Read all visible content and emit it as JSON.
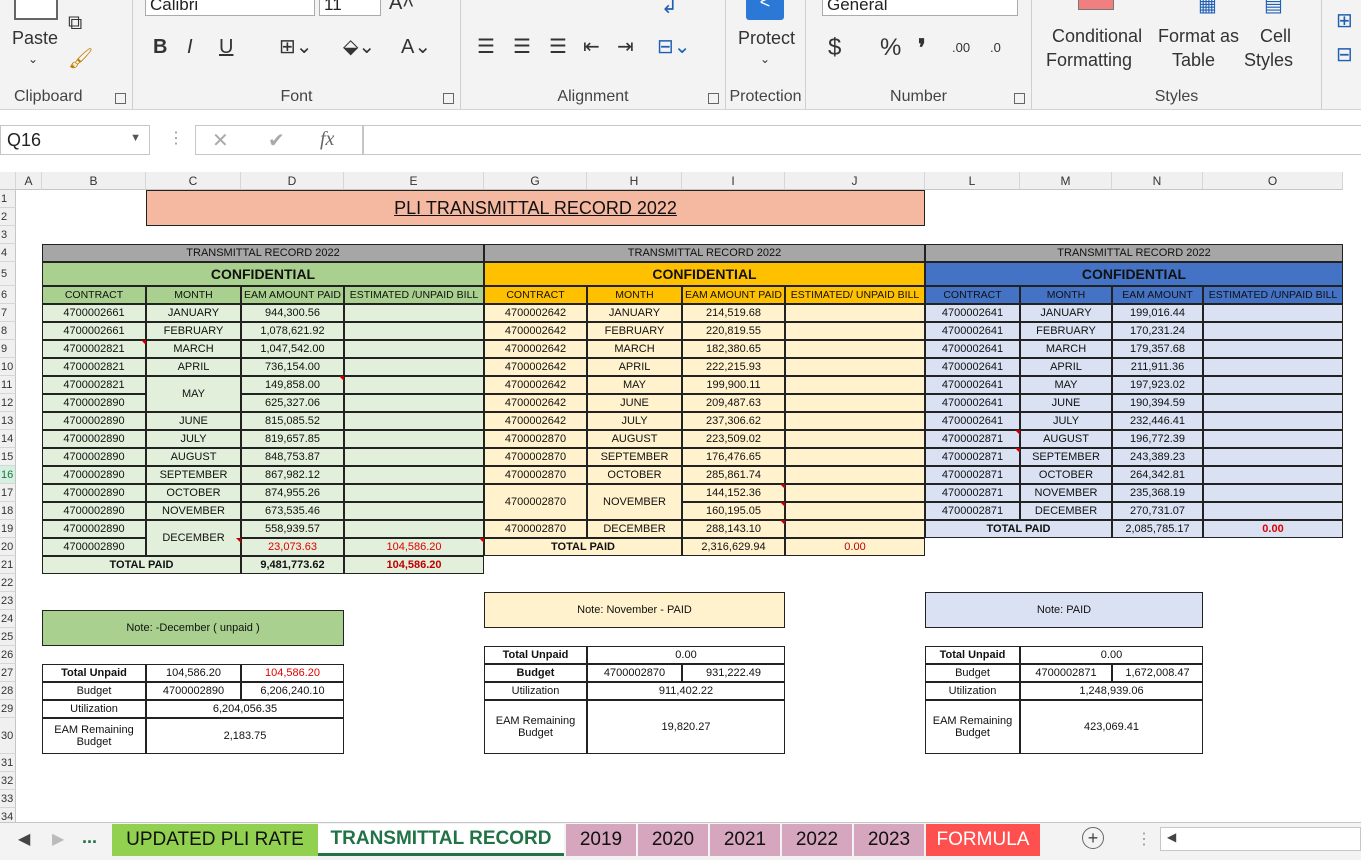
{
  "ribbon": {
    "font_name": "Calibri",
    "font_size": "11",
    "number_format": "General",
    "paste": "Paste",
    "protect": "Protect",
    "cond1": "Conditional",
    "cond2": "Formatting",
    "fmt1": "Format as",
    "fmt2": "Table",
    "cell1": "Cell",
    "cell2": "Styles",
    "groups": [
      "Clipboard",
      "Font",
      "Alignment",
      "Protection",
      "Number",
      "Styles"
    ],
    "bold": "B",
    "italic": "I",
    "underline": "U",
    "currency": "$",
    "percent": "%",
    "comma": "❜",
    "inc_dec": ".00",
    "dec_dec": ".0"
  },
  "formula_bar": {
    "name_box": "Q16",
    "fx": "fx",
    "cancel": "✕",
    "enter": "✔"
  },
  "columns": [
    "A",
    "B",
    "C",
    "D",
    "E",
    "G",
    "H",
    "I",
    "J",
    "L",
    "M",
    "N",
    "O"
  ],
  "rows": [
    "1",
    "2",
    "3",
    "4",
    "5",
    "6",
    "7",
    "8",
    "9",
    "10",
    "11",
    "12",
    "13",
    "14",
    "15",
    "16",
    "17",
    "18",
    "19",
    "20",
    "21",
    "22",
    "23",
    "24",
    "25",
    "26",
    "27",
    "28",
    "29",
    "30",
    "31",
    "32",
    "33",
    "34"
  ],
  "title": "PLI TRANSMITTAL RECORD 2022",
  "t1": {
    "header": "TRANSMITTAL RECORD 2022",
    "conf": "CONFIDENTIAL",
    "cols": [
      "CONTRACT",
      "MONTH",
      "EAM AMOUNT PAID",
      "ESTIMATED /UNPAID BILL"
    ],
    "contracts": [
      "4700002661",
      "4700002661",
      "4700002821",
      "4700002821",
      "4700002821",
      "4700002890",
      "4700002890",
      "4700002890",
      "4700002890",
      "4700002890",
      "4700002890",
      "4700002890",
      "4700002890",
      "4700002890"
    ],
    "months": [
      "JANUARY",
      "FEBRUARY",
      "MARCH",
      "APRIL",
      "MAY",
      "JUNE",
      "JULY",
      "AUGUST",
      "SEPTEMBER",
      "OCTOBER",
      "NOVEMBER",
      "DECEMBER"
    ],
    "amounts": [
      "944,300.56",
      "1,078,621.92",
      "1,047,542.00",
      "736,154.00",
      "149,858.00",
      "625,327.06",
      "815,085.52",
      "819,657.85",
      "848,753.87",
      "867,982.12",
      "874,955.26",
      "673,535.46",
      "558,939.57",
      "23,073.63"
    ],
    "unpaid_row20": "104,586.20",
    "total_label": "TOTAL PAID",
    "total_paid": "9,481,773.62",
    "total_unpaid": "104,586.20",
    "note": "Note: -December ( unpaid )",
    "sum": {
      "l1": "Total Unpaid",
      "v1a": "104,586.20",
      "v1b": "104,586.20",
      "l2": "Budget",
      "v2a": "4700002890",
      "v2b": "6,206,240.10",
      "l3": "Utilization",
      "v3": "6,204,056.35",
      "l4a": "EAM Remaining",
      "l4b": "Budget",
      "v4": "2,183.75"
    }
  },
  "t2": {
    "header": "TRANSMITTAL RECORD 2022",
    "conf": "CONFIDENTIAL",
    "cols": [
      "CONTRACT",
      "MONTH",
      "EAM AMOUNT PAID",
      "ESTIMATED/ UNPAID BILL"
    ],
    "contracts": [
      "4700002642",
      "4700002642",
      "4700002642",
      "4700002642",
      "4700002642",
      "4700002642",
      "4700002642",
      "4700002870",
      "4700002870",
      "4700002870",
      "4700002870",
      "4700002870"
    ],
    "months": [
      "JANUARY",
      "FEBRUARY",
      "MARCH",
      "APRIL",
      "MAY",
      "JUNE",
      "JULY",
      "AUGUST",
      "SEPTEMBER",
      "OCTOBER",
      "NOVEMBER",
      "DECEMBER"
    ],
    "amounts": [
      "214,519.68",
      "220,819.55",
      "182,380.65",
      "222,215.93",
      "199,900.11",
      "209,487.63",
      "237,306.62",
      "223,509.02",
      "176,476.65",
      "285,861.74",
      "144,152.36",
      "160,195.05",
      "288,143.10"
    ],
    "total_label": "TOTAL PAID",
    "total_paid": "2,316,629.94",
    "total_unpaid": "0.00",
    "note": "Note: November - PAID",
    "sum": {
      "l1": "Total Unpaid",
      "v1": "0.00",
      "l2": "Budget",
      "v2a": "4700002870",
      "v2b": "931,222.49",
      "l3": "Utilization",
      "v3": "911,402.22",
      "l4a": "EAM Remaining",
      "l4b": "Budget",
      "v4": "19,820.27"
    }
  },
  "t3": {
    "header": "TRANSMITTAL RECORD 2022",
    "conf": "CONFIDENTIAL",
    "cols": [
      "CONTRACT",
      "MONTH",
      "EAM AMOUNT",
      "ESTIMATED /UNPAID BILL"
    ],
    "contracts": [
      "4700002641",
      "4700002641",
      "4700002641",
      "4700002641",
      "4700002641",
      "4700002641",
      "4700002641",
      "4700002871",
      "4700002871",
      "4700002871",
      "4700002871",
      "4700002871"
    ],
    "months": [
      "JANUARY",
      "FEBRUARY",
      "MARCH",
      "APRIL",
      "MAY",
      "JUNE",
      "JULY",
      "AUGUST",
      "SEPTEMBER",
      "OCTOBER",
      "NOVEMBER",
      "DECEMBER"
    ],
    "amounts": [
      "199,016.44",
      "170,231.24",
      "179,357.68",
      "211,911.36",
      "197,923.02",
      "190,394.59",
      "232,446.41",
      "196,772.39",
      "243,389.23",
      "264,342.81",
      "235,368.19",
      "270,731.07"
    ],
    "total_label": "TOTAL PAID",
    "total_paid": "2,085,785.17",
    "total_unpaid": "0.00",
    "note": "Note: PAID",
    "sum": {
      "l1": "Total Unpaid",
      "v1": "0.00",
      "l2": "Budget",
      "v2a": "4700002871",
      "v2b": "1,672,008.47",
      "l3": "Utilization",
      "v3": "1,248,939.06",
      "l4a": "EAM Remaining",
      "l4b": "Budget",
      "v4": "423,069.41"
    }
  },
  "tabs": {
    "more": "...",
    "items": [
      "UPDATED PLI RATE",
      "TRANSMITTAL RECORD",
      "2019",
      "2020",
      "2021",
      "2022",
      "2023",
      "FORMULA"
    ],
    "add": "+"
  },
  "colors": {
    "green": "#a9d08e",
    "green_light": "#e2efda",
    "yellow": "#ffc000",
    "yellow_light": "#fff2cc",
    "blue": "#4472c4",
    "blue_light": "#d9e1f2",
    "title_bg": "#f4b9a0",
    "gray": "#a6a6a6"
  }
}
